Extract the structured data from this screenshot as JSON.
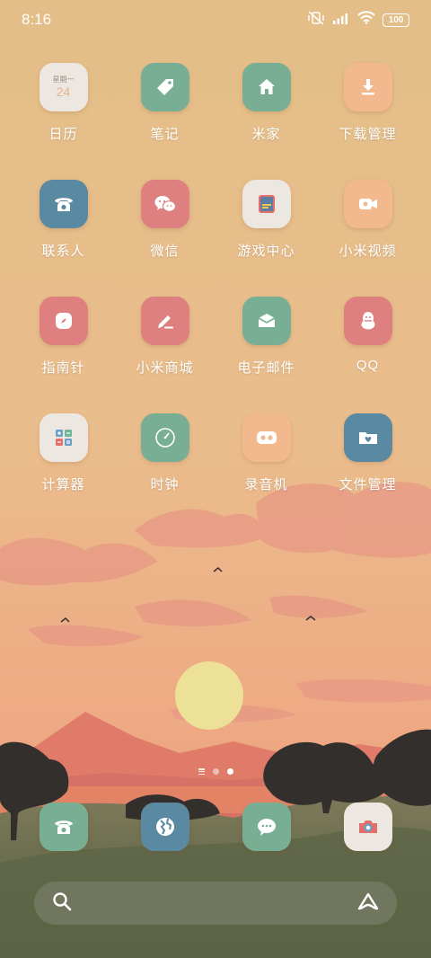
{
  "status_bar": {
    "time": "8:16",
    "battery": "100",
    "icons": [
      "vibrate-off-icon",
      "signal-icon",
      "wifi-icon",
      "battery-icon"
    ]
  },
  "home": {
    "apps": [
      {
        "label": "日历",
        "icon": "calendar-icon",
        "color": "#ece7e1",
        "calendar_weekday": "星期一",
        "calendar_day": "24"
      },
      {
        "label": "笔记",
        "icon": "tag-icon",
        "color": "#78ae94"
      },
      {
        "label": "米家",
        "icon": "house-icon",
        "color": "#78ae94"
      },
      {
        "label": "下载管理",
        "icon": "download-icon",
        "color": "#f2b88e"
      },
      {
        "label": "联系人",
        "icon": "phone-icon",
        "color": "#5a89a2"
      },
      {
        "label": "微信",
        "icon": "wechat-icon",
        "color": "#de7f80"
      },
      {
        "label": "游戏中心",
        "icon": "game-center-icon",
        "color": "#ece7e1"
      },
      {
        "label": "小米视频",
        "icon": "video-camera-icon",
        "color": "#f2b88e"
      },
      {
        "label": "指南针",
        "icon": "compass-icon",
        "color": "#de7f80"
      },
      {
        "label": "小米商城",
        "icon": "pencil-icon",
        "color": "#de7f80"
      },
      {
        "label": "电子邮件",
        "icon": "envelope-icon",
        "color": "#78ae94"
      },
      {
        "label": "QQ",
        "icon": "penguin-icon",
        "color": "#de7f80"
      },
      {
        "label": "计算器",
        "icon": "calculator-icon",
        "color": "#ece7e1"
      },
      {
        "label": "时钟",
        "icon": "clock-icon",
        "color": "#78ae94"
      },
      {
        "label": "录音机",
        "icon": "recorder-icon",
        "color": "#f2b88e"
      },
      {
        "label": "文件管理",
        "icon": "folder-icon",
        "color": "#5a89a2"
      }
    ]
  },
  "page_indicator": {
    "pages": 2,
    "current": 2
  },
  "dock": {
    "apps": [
      {
        "icon": "phone-icon",
        "color": "#78ae94"
      },
      {
        "icon": "browser-icon",
        "color": "#5a89a2"
      },
      {
        "icon": "message-icon",
        "color": "#78ae94"
      },
      {
        "icon": "camera-icon",
        "color": "#ece7e1"
      }
    ]
  },
  "search_bar": {
    "icons": [
      "search-icon",
      "assistant-icon"
    ]
  }
}
